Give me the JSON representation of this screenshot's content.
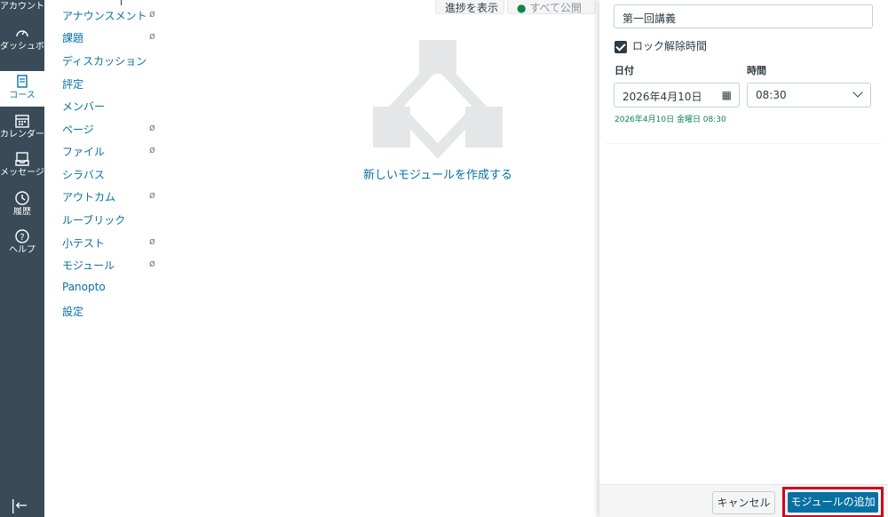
{
  "global_nav": {
    "items": [
      {
        "label": "アカウント",
        "icon": "account-icon"
      },
      {
        "label": "ダッシュボード",
        "icon": "dashboard-icon"
      },
      {
        "label": "コース",
        "icon": "courses-icon",
        "active": true
      },
      {
        "label": "カレンダー",
        "icon": "calendar-icon"
      },
      {
        "label": "メッセージ",
        "icon": "inbox-icon"
      },
      {
        "label": "履歴",
        "icon": "history-icon"
      },
      {
        "label": "ヘルプ",
        "icon": "help-icon"
      }
    ],
    "collapse_icon": "collapse-icon"
  },
  "course_nav": {
    "items": [
      {
        "label": "アナウンスメント",
        "hidden": true
      },
      {
        "label": "課題",
        "hidden": true
      },
      {
        "label": "ディスカッション",
        "hidden": false
      },
      {
        "label": "評定",
        "hidden": false
      },
      {
        "label": "メンバー",
        "hidden": false
      },
      {
        "label": "ページ",
        "hidden": true
      },
      {
        "label": "ファイル",
        "hidden": true
      },
      {
        "label": "シラバス",
        "hidden": false
      },
      {
        "label": "アウトカム",
        "hidden": true
      },
      {
        "label": "ルーブリック",
        "hidden": false
      },
      {
        "label": "小テスト",
        "hidden": true
      },
      {
        "label": "モジュール",
        "hidden": true
      },
      {
        "label": "Panopto",
        "hidden": false
      },
      {
        "label": "設定",
        "hidden": false
      }
    ]
  },
  "header": {
    "progress_button": "進捗を表示",
    "publish_all_button": "すべて公開"
  },
  "empty_state": {
    "text": "新しいモジュールを作成する"
  },
  "tray": {
    "module_name_value": "第一回講義",
    "lock_until_label": "ロック解除時間",
    "lock_until_checked": true,
    "date_label": "日付",
    "time_label": "時間",
    "date_value": "2026年4月10日",
    "time_value": "08:30",
    "date_note": "2026年4月10日 金曜日 08:30",
    "cancel_button": "キャンセル",
    "add_button": "モジュールの追加"
  },
  "colors": {
    "nav_bg": "#394b58",
    "link": "#0770a3",
    "success": "#0b874b",
    "highlight": "#d0021b"
  }
}
